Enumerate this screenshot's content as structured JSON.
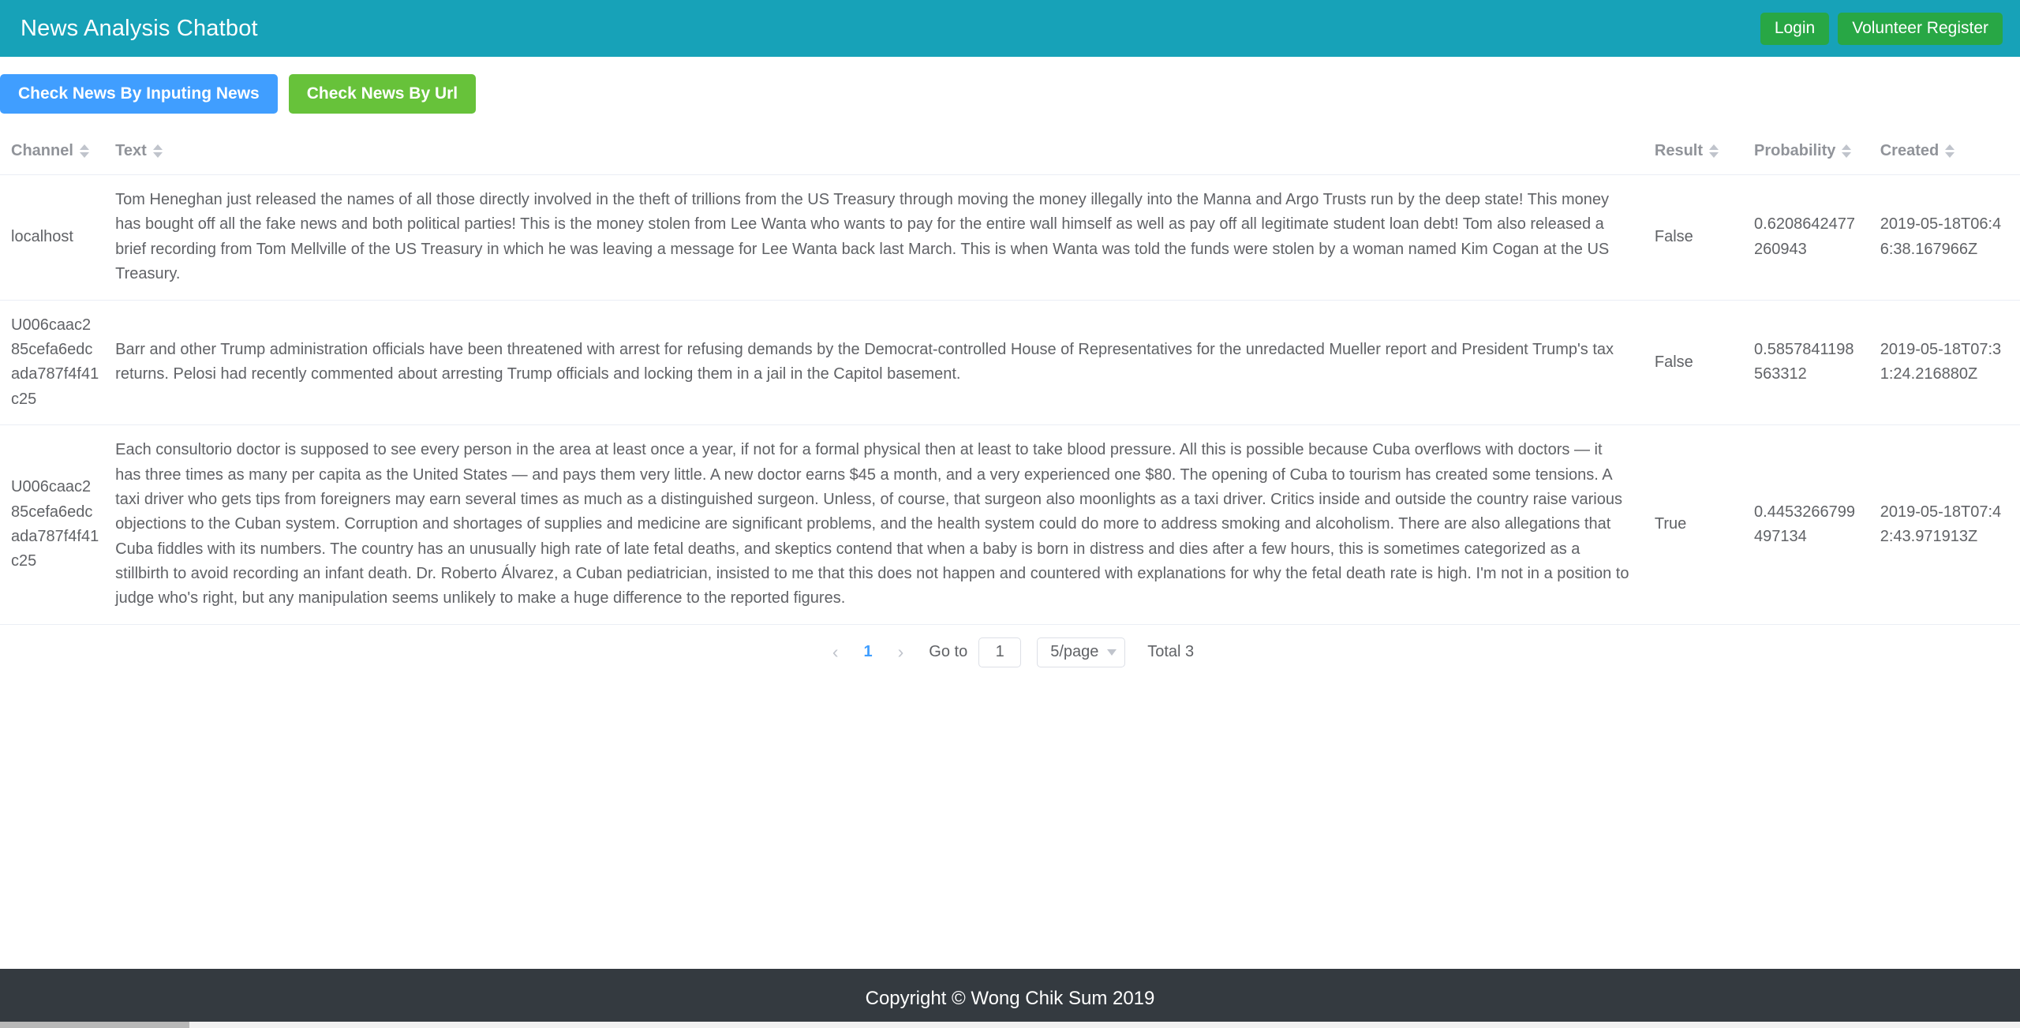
{
  "header": {
    "brand": "News Analysis Chatbot",
    "login_label": "Login",
    "register_label": "Volunteer Register"
  },
  "actions": {
    "check_by_input_label": "Check News By Inputing News",
    "check_by_url_label": "Check News By Url"
  },
  "table": {
    "columns": [
      {
        "key": "channel",
        "label": "Channel"
      },
      {
        "key": "text",
        "label": "Text"
      },
      {
        "key": "result",
        "label": "Result"
      },
      {
        "key": "probability",
        "label": "Probability"
      },
      {
        "key": "created",
        "label": "Created"
      }
    ],
    "rows": [
      {
        "channel": "localhost",
        "text": "Tom Heneghan just released the names of all those directly involved in the theft of trillions from the US Treasury through moving the money illegally into the Manna and Argo Trusts run by the deep state! This money has bought off all the fake news and both political parties! This is the money stolen from Lee Wanta who wants to pay for the entire wall himself as well as pay off all legitimate student loan debt! Tom also released a brief recording from Tom Mellville of the US Treasury in which he was leaving a message for Lee Wanta back last March. This is when Wanta was told the funds were stolen by a woman named Kim Cogan at the US Treasury.",
        "result": "False",
        "probability": "0.6208642477260943",
        "created": "2019-05-18T06:46:38.167966Z"
      },
      {
        "channel": "U006caac285cefa6edcada787f4f41c25",
        "text": "Barr and other Trump administration officials have been threatened with arrest for refusing demands by the Democrat-controlled House of Representatives for the unredacted Mueller report and President Trump's tax returns. Pelosi had recently commented about arresting Trump officials and locking them in a jail in the Capitol basement.",
        "result": "False",
        "probability": "0.5857841198563312",
        "created": "2019-05-18T07:31:24.216880Z"
      },
      {
        "channel": "U006caac285cefa6edcada787f4f41c25",
        "text": "Each consultorio doctor is supposed to see every person in the area at least once a year, if not for a formal physical then at least to take blood pressure. All this is possible because Cuba overflows with doctors — it has three times as many per capita as the United States — and pays them very little. A new doctor earns $45 a month, and a very experienced one $80. The opening of Cuba to tourism has created some tensions. A taxi driver who gets tips from foreigners may earn several times as much as a distinguished surgeon. Unless, of course, that surgeon also moonlights as a taxi driver. Critics inside and outside the country raise various objections to the Cuban system. Corruption and shortages of supplies and medicine are significant problems, and the health system could do more to address smoking and alcoholism. There are also allegations that Cuba fiddles with its numbers. The country has an unusually high rate of late fetal deaths, and skeptics contend that when a baby is born in distress and dies after a few hours, this is sometimes categorized as a stillbirth to avoid recording an infant death. Dr. Roberto Álvarez, a Cuban pediatrician, insisted to me that this does not happen and countered with explanations for why the fetal death rate is high. I'm not in a position to judge who's right, but any manipulation seems unlikely to make a huge difference to the reported figures.",
        "result": "True",
        "probability": "0.4453266799497134",
        "created": "2019-05-18T07:42:43.971913Z"
      }
    ]
  },
  "pagination": {
    "prev_icon": "chevron-left-icon",
    "next_icon": "chevron-right-icon",
    "current_page": "1",
    "goto_label": "Go to",
    "goto_value": "1",
    "page_size": "5/page",
    "total_label": "Total 3"
  },
  "footer": {
    "copyright": "Copyright © Wong Chik Sum 2019"
  },
  "colors": {
    "navbar": "#17a2b8",
    "green": "#28a745",
    "blue": "#409eff",
    "light_green": "#67c23a",
    "footer": "#343a40"
  }
}
